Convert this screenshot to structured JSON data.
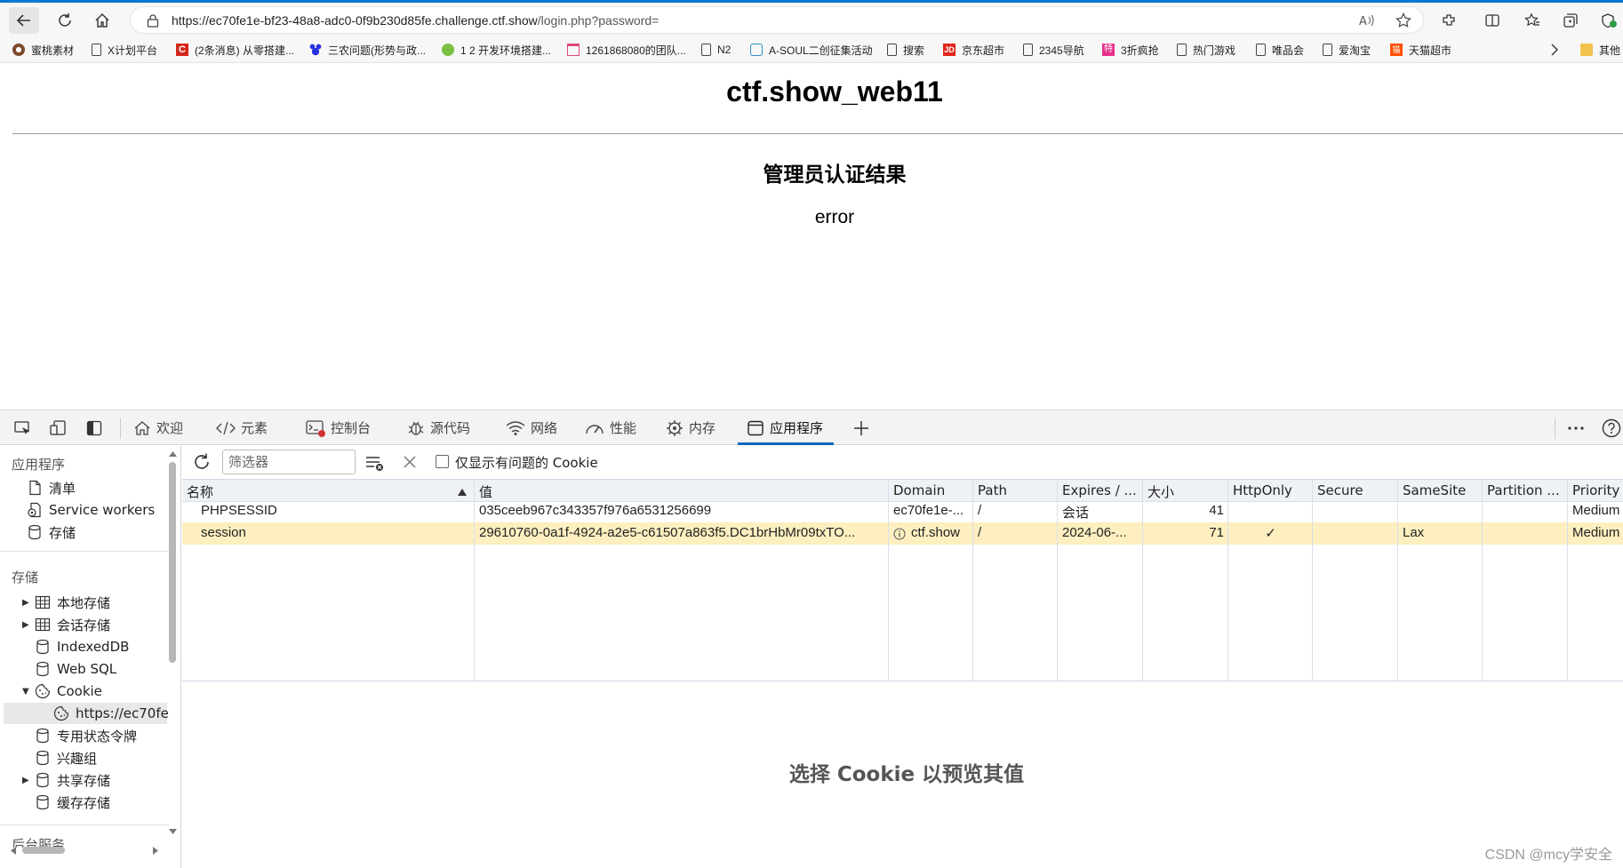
{
  "browser": {
    "url_host": "https://ec70fe1e-bf23-48a8-adc0-0f9b230d85fe.challenge.ctf.show",
    "url_path": "/login.php?password=",
    "bookmarks": [
      "蜜桃素材",
      "X计划平台",
      "(2条消息) 从零搭建...",
      "三农问题(形势与政...",
      "1 2 开发环境搭建...",
      "1261868080的团队...",
      "N2",
      "A-SOUL二创征集活动",
      "搜索",
      "京东超市",
      "2345导航",
      "3折疯抢",
      "热门游戏",
      "唯品会",
      "爱淘宝",
      "天猫超市",
      "其他"
    ]
  },
  "page": {
    "title": "ctf.show_web11",
    "heading": "管理员认证结果",
    "result": "error"
  },
  "devtools": {
    "tabs": [
      "欢迎",
      "元素",
      "控制台",
      "源代码",
      "网络",
      "性能",
      "内存",
      "应用程序"
    ],
    "active_tab": "应用程序",
    "sidebar": {
      "section_app": "应用程序",
      "app_items": [
        "清单",
        "Service workers",
        "存储"
      ],
      "section_storage": "存储",
      "storage_items": [
        "本地存储",
        "会话存储",
        "IndexedDB",
        "Web SQL",
        "Cookie",
        "https://ec70fe",
        "专用状态令牌",
        "兴趣组",
        "共享存储",
        "缓存存储"
      ],
      "section_bg": "后台服务"
    },
    "toolbar": {
      "filter_placeholder": "筛选器",
      "only_issues_label": "仅显示有问题的 Cookie"
    },
    "table": {
      "headers": [
        "名称",
        "值",
        "Domain",
        "Path",
        "Expires / ...",
        "大小",
        "HttpOnly",
        "Secure",
        "SameSite",
        "Partition ...",
        "Priority"
      ],
      "rows": [
        {
          "name": "PHPSESSID",
          "value": "035ceeb967c343357f976a6531256699",
          "domain": "ec70fe1e-...",
          "path": "/",
          "expires": "会话",
          "size": "41",
          "httponly": "",
          "secure": "",
          "samesite": "",
          "partition": "",
          "priority": "Medium"
        },
        {
          "name": "session",
          "value": "29610760-0a1f-4924-a2e5-c61507a863f5.DC1brHbMr09txTO...",
          "domain": "ctf.show",
          "path": "/",
          "expires": "2024-06-...",
          "size": "71",
          "httponly": "✓",
          "secure": "",
          "samesite": "Lax",
          "partition": "",
          "priority": "Medium"
        }
      ]
    },
    "preview_message": "选择 Cookie 以预览其值"
  },
  "watermark": "CSDN @mcy学安全",
  "colors": {
    "accent": "#0067c0",
    "selected_row": "#fdefc0"
  }
}
